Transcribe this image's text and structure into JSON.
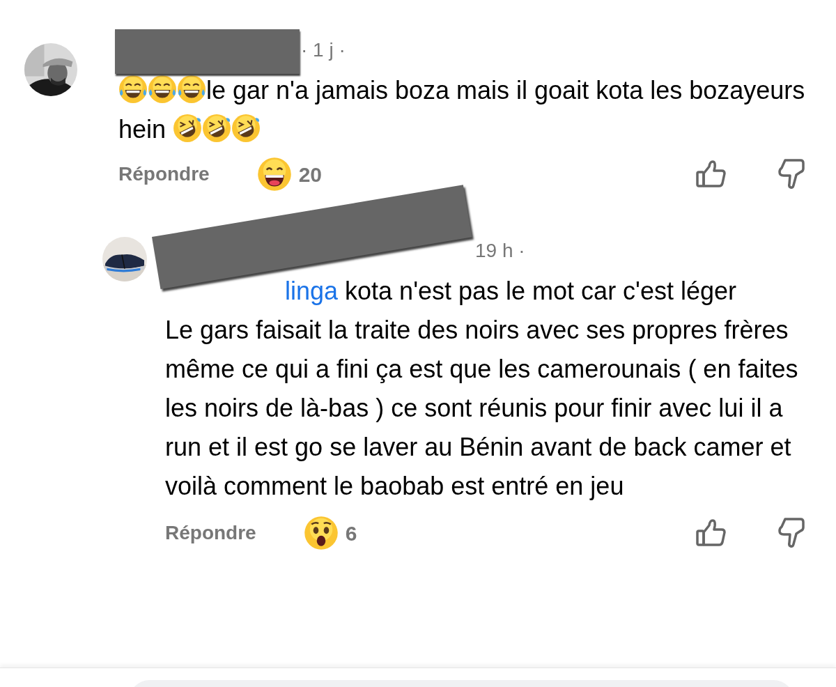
{
  "comments": [
    {
      "time": "· 1 j ·",
      "body": [
        {
          "kind": "joy"
        },
        {
          "kind": "joy"
        },
        {
          "kind": "joy"
        },
        {
          "kind": "text",
          "text": "le gar n'a jamais boza mais il goait kota les bozayeurs hein "
        },
        {
          "kind": "rofl"
        },
        {
          "kind": "rofl"
        },
        {
          "kind": "rofl"
        }
      ],
      "reply_label": "Répondre",
      "reaction": {
        "kind": "grin",
        "count": "20"
      },
      "reply": false
    },
    {
      "time": "19 h ·",
      "body": [
        {
          "kind": "mention",
          "text": "linga"
        },
        {
          "kind": "text",
          "text": " kota n'est pas le mot car c'est léger\nLe gars faisait la traite des noirs avec ses propres frères même ce qui a fini ça est que les camerounais ( en faites les noirs de là-bas ) ce sont réunis pour finir avec lui il a run et il est go se laver au Bénin avant de back camer et voilà comment le baobab est entré en jeu"
        }
      ],
      "reply_label": "Répondre",
      "reaction": {
        "kind": "wow",
        "count": "6"
      },
      "reply": true
    }
  ],
  "comment_field": {
    "kind": "field"
  }
}
